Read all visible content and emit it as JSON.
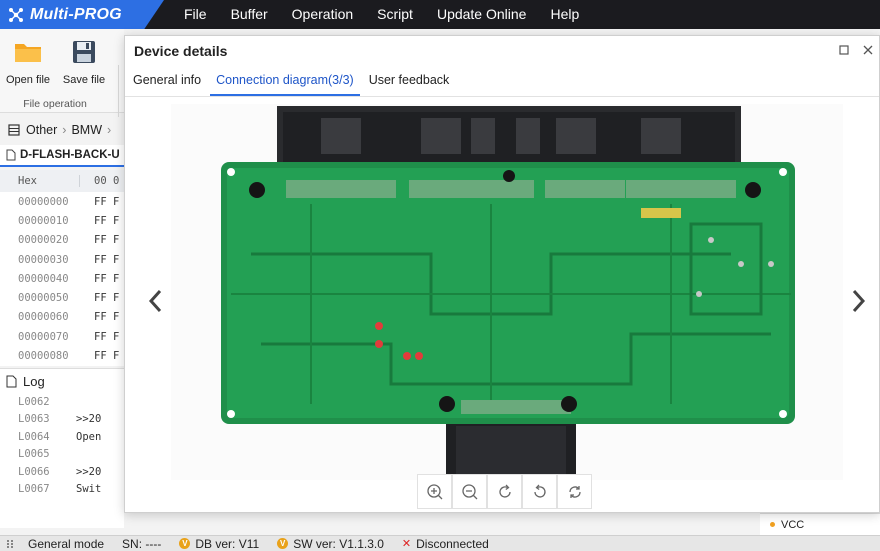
{
  "app": {
    "title": "Multi-PROG",
    "brand_color": "#2d6fe3",
    "menu": [
      "File",
      "Buffer",
      "Operation",
      "Script",
      "Update Online",
      "Help"
    ]
  },
  "toolbar": {
    "open_label": "Open file",
    "save_label": "Save file",
    "group_label": "File operation"
  },
  "breadcrumb": [
    "Other",
    "BMW"
  ],
  "file_tab": {
    "name": "D-FLASH-BACK-U"
  },
  "hex": {
    "header_addr": "Hex",
    "header_cols": "00 0",
    "rows": [
      {
        "addr": "00000000",
        "val": "FF F"
      },
      {
        "addr": "00000010",
        "val": "FF F"
      },
      {
        "addr": "00000020",
        "val": "FF F"
      },
      {
        "addr": "00000030",
        "val": "FF F"
      },
      {
        "addr": "00000040",
        "val": "FF F"
      },
      {
        "addr": "00000050",
        "val": "FF F"
      },
      {
        "addr": "00000060",
        "val": "FF F"
      },
      {
        "addr": "00000070",
        "val": "FF F"
      },
      {
        "addr": "00000080",
        "val": "FF F"
      }
    ]
  },
  "log": {
    "title": "Log",
    "lines": [
      {
        "ln": "L0062",
        "txt": ""
      },
      {
        "ln": "L0063",
        "txt": ">>20"
      },
      {
        "ln": "L0064",
        "txt": "Open"
      },
      {
        "ln": "L0065",
        "txt": ""
      },
      {
        "ln": "L0066",
        "txt": ">>20"
      },
      {
        "ln": "L0067",
        "txt": "Swit"
      }
    ]
  },
  "right_panel": {
    "vcc_label": "VCC"
  },
  "dialog": {
    "title": "Device details",
    "tabs": [
      {
        "label": "General info",
        "active": false
      },
      {
        "label": "Connection diagram(3/3)",
        "active": true
      },
      {
        "label": "User feedback",
        "active": false
      }
    ],
    "image_icon": "pcb-board-photo",
    "zoom_buttons": [
      "zoom-in-icon",
      "zoom-out-icon",
      "rotate-right-icon",
      "rotate-left-icon",
      "reset-icon"
    ]
  },
  "status": {
    "mode": "General mode",
    "sn": "SN:  ----",
    "db_ver": "DB ver: V11",
    "sw_ver": "SW ver: V1.1.3.0",
    "connection": "Disconnected",
    "badge_letter": "V",
    "disconnected_color": "#dd2222"
  }
}
